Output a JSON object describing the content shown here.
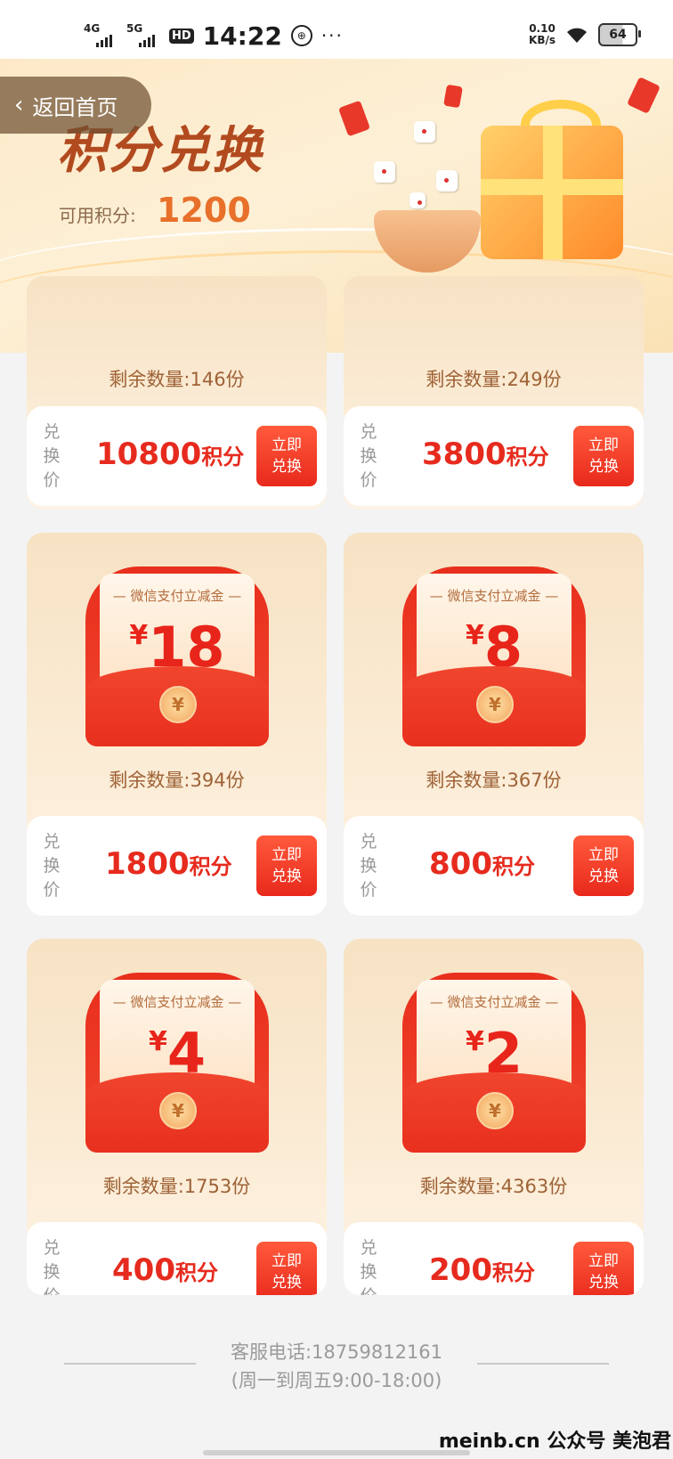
{
  "status_bar": {
    "net1": "4G",
    "net2": "5G",
    "hd": "HD",
    "time": "14:22",
    "more": "···",
    "speed_value": "0.10",
    "speed_unit": "KB/s",
    "battery": "64"
  },
  "header": {
    "back_label": "返回首页",
    "title": "积分兑换",
    "points_label": "可用积分:",
    "points_value": "1200"
  },
  "colors": {
    "accent": "#e62b1e",
    "button": "#ef3b24",
    "banner": "#fde9c8"
  },
  "cards": [
    {
      "stock_label": "剩余数量:146份",
      "price_label": "兑换价",
      "price_num": "10800",
      "price_unit": "积分",
      "button": "立即兑换"
    },
    {
      "stock_label": "剩余数量:249份",
      "price_label": "兑换价",
      "price_num": "3800",
      "price_unit": "积分",
      "button": "立即兑换"
    },
    {
      "coupon_title": "— 微信支付立减金 —",
      "currency": "¥",
      "amount": "18",
      "stock_label": "剩余数量:394份",
      "price_label": "兑换价",
      "price_num": "1800",
      "price_unit": "积分",
      "button": "立即兑换"
    },
    {
      "coupon_title": "— 微信支付立减金 —",
      "currency": "¥",
      "amount": "8",
      "stock_label": "剩余数量:367份",
      "price_label": "兑换价",
      "price_num": "800",
      "price_unit": "积分",
      "button": "立即兑换"
    },
    {
      "coupon_title": "— 微信支付立减金 —",
      "currency": "¥",
      "amount": "4",
      "stock_label": "剩余数量:1753份",
      "price_label": "兑换价",
      "price_num": "400",
      "price_unit": "积分",
      "button": "立即兑换"
    },
    {
      "coupon_title": "— 微信支付立减金 —",
      "currency": "¥",
      "amount": "2",
      "stock_label": "剩余数量:4363份",
      "price_label": "兑换价",
      "price_num": "200",
      "price_unit": "积分",
      "button": "立即兑换"
    }
  ],
  "footer": {
    "phone": "客服电话:18759812161",
    "hours": "(周一到周五9:00-18:00)"
  },
  "watermark": "meinb.cn 公众号 美泡君"
}
